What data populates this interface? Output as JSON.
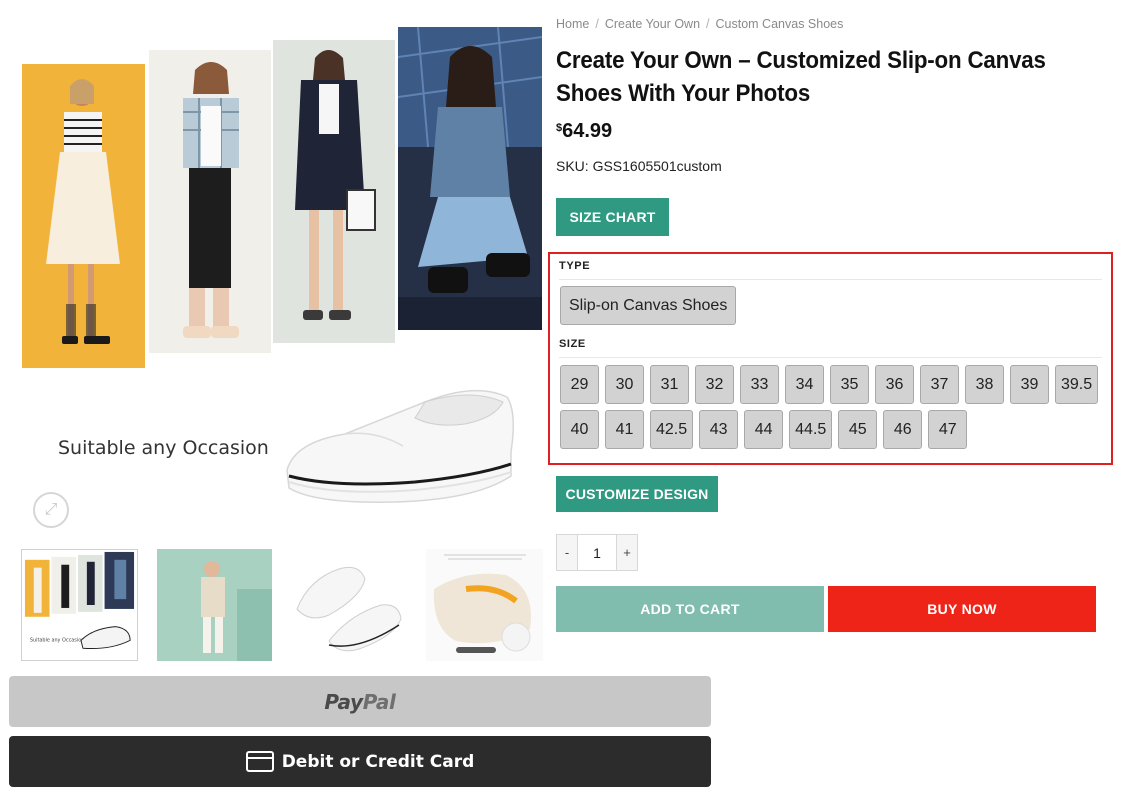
{
  "breadcrumb": {
    "items": [
      "Home",
      "Create Your Own",
      "Custom Canvas Shoes"
    ],
    "separator": "/"
  },
  "product": {
    "title": "Create Your Own – Customized Slip-on Canvas Shoes With Your Photos",
    "price_currency": "$",
    "price_value": "64.99",
    "sku": "SKU: GSS1605501custom"
  },
  "buttons": {
    "size_chart": "SIZE CHART",
    "customize_design": "CUSTOMIZE DESIGN",
    "add_to_cart": "ADD TO CART",
    "buy_now": "BUY NOW",
    "paypal_part1": "Pay",
    "paypal_part2": "Pal",
    "card": "Debit or Credit Card"
  },
  "variations": {
    "type_label": "TYPE",
    "type_options": [
      "Slip-on Canvas Shoes"
    ],
    "size_label": "SIZE",
    "size_rows": [
      [
        "29",
        "30",
        "31",
        "32",
        "33",
        "34",
        "35",
        "36",
        "37",
        "38",
        "39",
        "39.5"
      ],
      [
        "40",
        "41",
        "42.5",
        "43",
        "44",
        "44.5",
        "45",
        "46",
        "47"
      ]
    ]
  },
  "quantity": {
    "minus": "-",
    "value": "1",
    "plus": "+"
  },
  "gallery": {
    "caption": "Suitable any Occasion",
    "zoom_icon": "expand-arrows-icon"
  },
  "colors": {
    "teal": "#2f9982",
    "teal_light": "#80bdae",
    "red": "#ee2419",
    "highlight_border": "#e02020",
    "paypal_bg": "#c7c7c7",
    "card_bg": "#2c2c2c"
  }
}
